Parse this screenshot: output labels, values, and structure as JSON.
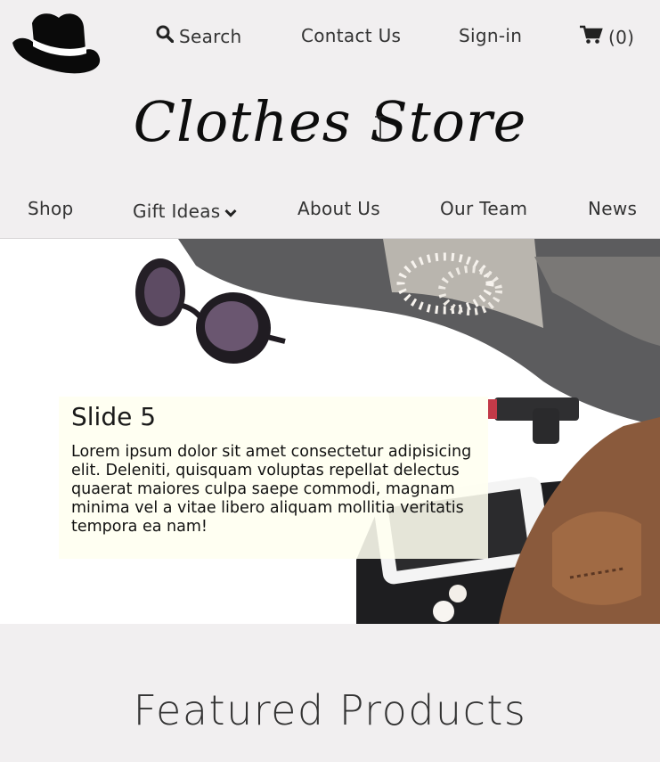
{
  "header": {
    "search_label": "Search",
    "contact_label": "Contact Us",
    "signin_label": "Sign-in",
    "cart_count": "(0)"
  },
  "brand": {
    "title": "Clothes Store"
  },
  "nav": {
    "items": [
      {
        "label": "Shop"
      },
      {
        "label": "Gift Ideas"
      },
      {
        "label": "About Us"
      },
      {
        "label": "Our Team"
      },
      {
        "label": "News"
      }
    ]
  },
  "hero": {
    "slide_title": "Slide 5",
    "slide_text": "Lorem ipsum dolor sit amet consectetur adipisicing elit. Deleniti, quisquam voluptas repellat delectus quaerat maiores culpa saepe commodi, magnam minima vel a vitae libero aliquam mollitia veritatis tempora ea nam!"
  },
  "featured": {
    "heading": "Featured Products"
  },
  "icons": {
    "logo": "hat-icon",
    "search": "search-icon",
    "cart": "cart-icon",
    "dropdown": "chevron-down-icon"
  },
  "colors": {
    "page_bg": "#f1eff0",
    "caption_bg": "#fffff0",
    "text": "#333333"
  }
}
